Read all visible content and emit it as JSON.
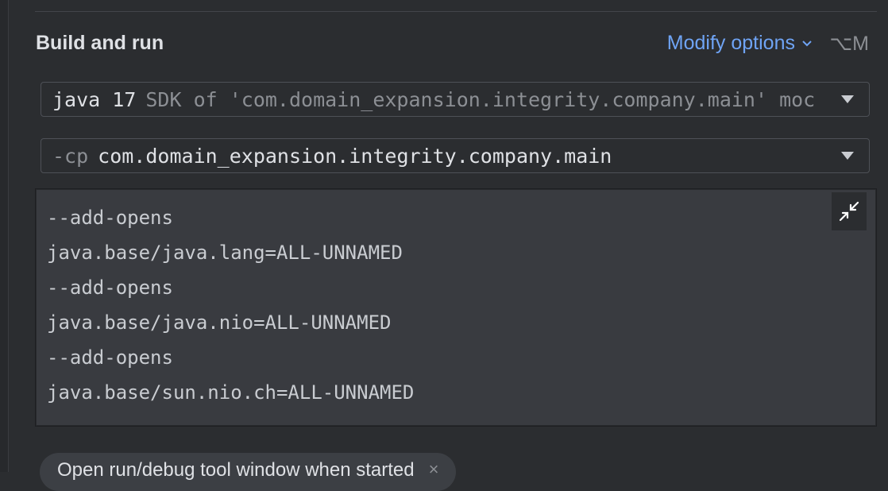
{
  "section": {
    "title": "Build and run",
    "modify_options_label": "Modify options",
    "modify_options_shortcut": "⌥M"
  },
  "jdk_combo": {
    "primary": "java 17",
    "secondary": "SDK of 'com.domain_expansion.integrity.company.main' moc"
  },
  "classpath_combo": {
    "prefix": "-cp",
    "value": "com.domain_expansion.integrity.company.main"
  },
  "vm_options": {
    "lines": [
      "--add-opens",
      "java.base/java.lang=ALL-UNNAMED",
      "--add-opens",
      "java.base/java.nio=ALL-UNNAMED",
      "--add-opens",
      "java.base/sun.nio.ch=ALL-UNNAMED"
    ]
  },
  "chip": {
    "label": "Open run/debug tool window when started",
    "close_glyph": "×"
  },
  "colors": {
    "background": "#2b2d30",
    "accent_link": "#6fa4f5",
    "editor_bg": "#393b40"
  },
  "icons": {
    "modify_options": "chevron-down-icon",
    "combo_arrow": "triangle-down-icon",
    "collapse": "collapse-arrows-icon"
  }
}
